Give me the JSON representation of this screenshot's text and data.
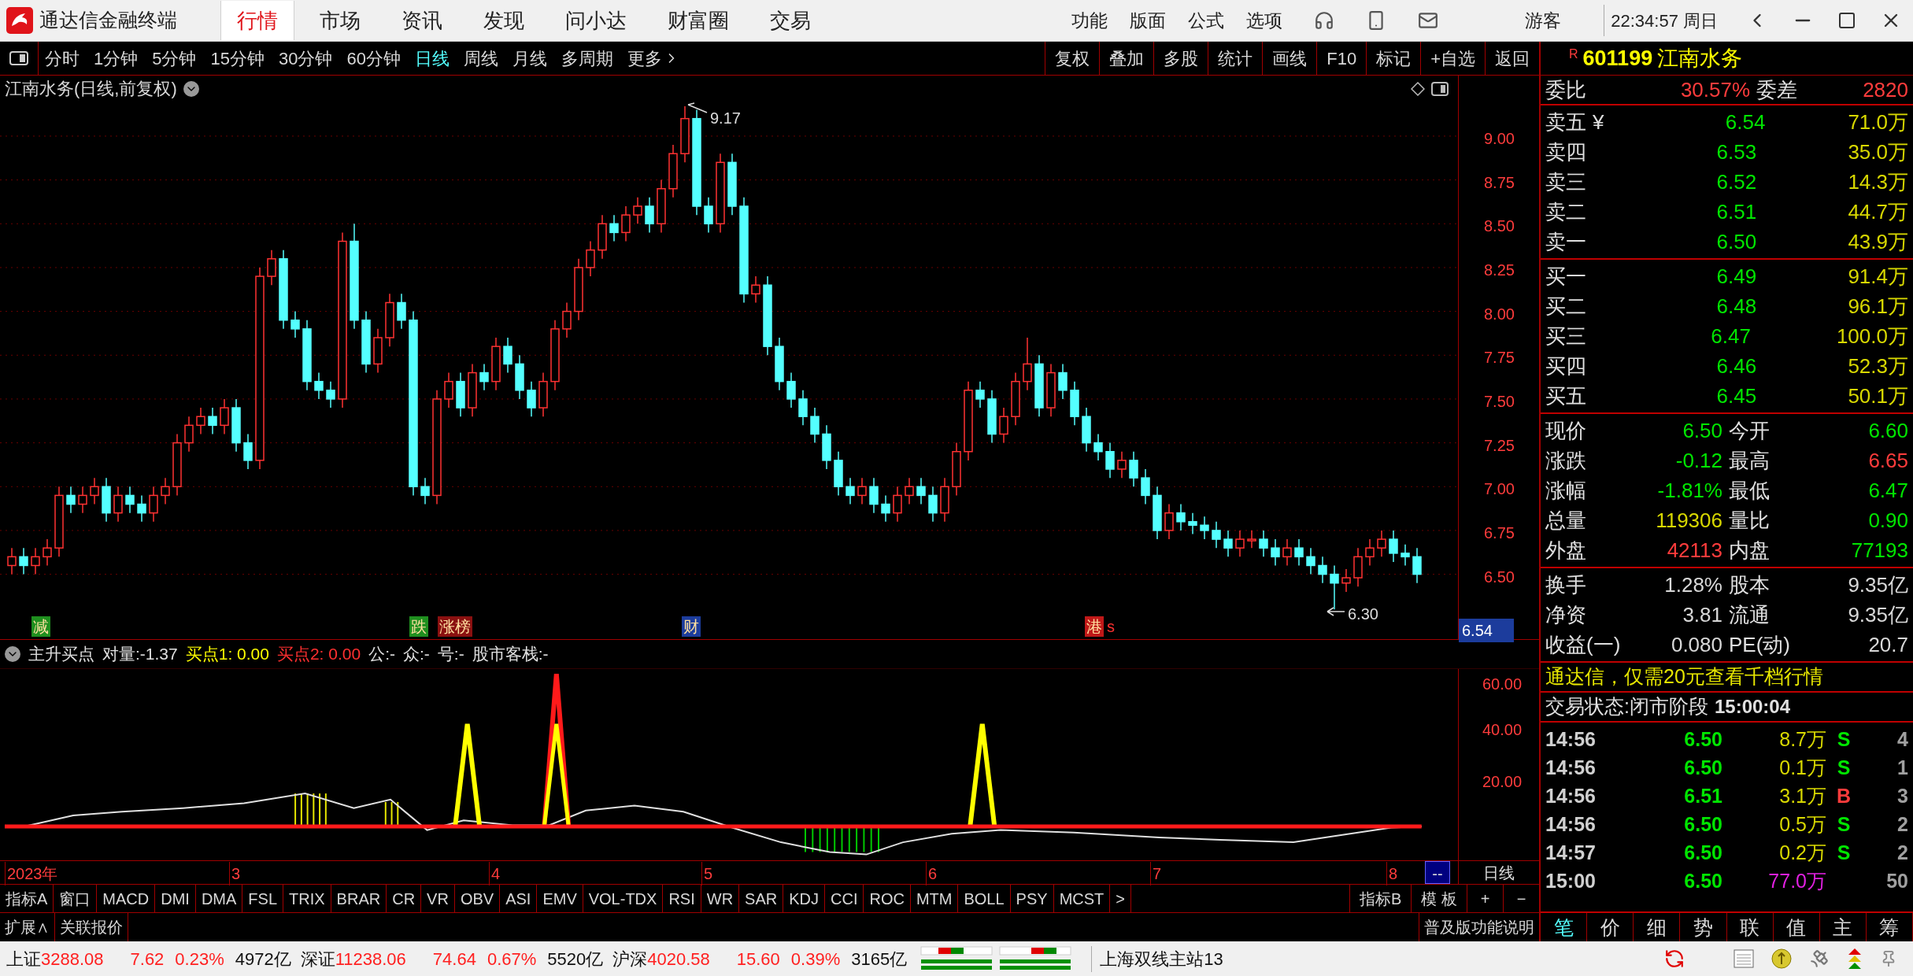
{
  "top_bar": {
    "app_title": "通达信金融终端",
    "tabs": [
      {
        "label": "行情",
        "selected": true
      },
      {
        "label": "市场",
        "selected": false
      },
      {
        "label": "资讯",
        "selected": false
      },
      {
        "label": "发现",
        "selected": false
      },
      {
        "label": "问小达",
        "selected": false
      },
      {
        "label": "财富圈",
        "selected": false
      },
      {
        "label": "交易",
        "selected": false
      }
    ],
    "menus": [
      "功能",
      "版面",
      "公式",
      "选项"
    ],
    "user": "游客",
    "clock": "22:34:57 周日"
  },
  "toolbar": {
    "periods": [
      {
        "label": "分时",
        "selected": false
      },
      {
        "label": "1分钟",
        "selected": false
      },
      {
        "label": "5分钟",
        "selected": false
      },
      {
        "label": "15分钟",
        "selected": false
      },
      {
        "label": "30分钟",
        "selected": false
      },
      {
        "label": "60分钟",
        "selected": false
      },
      {
        "label": "日线",
        "selected": true
      },
      {
        "label": "周线",
        "selected": false
      },
      {
        "label": "月线",
        "selected": false
      },
      {
        "label": "多周期",
        "selected": false
      }
    ],
    "more": "更多",
    "actions": [
      "复权",
      "叠加",
      "多股",
      "统计",
      "画线",
      "F10",
      "标记",
      "+自选",
      "返回"
    ]
  },
  "main_chart": {
    "title": "江南水务(日线,前复权)",
    "chart_data": {
      "type": "candlestick",
      "ylim": [
        6.13,
        9.35
      ],
      "grid": true,
      "yticks": [
        {
          "value": 9.0,
          "label": "9.00"
        },
        {
          "value": 8.75,
          "label": "8.75"
        },
        {
          "value": 8.5,
          "label": "8.50"
        },
        {
          "value": 8.25,
          "label": "8.25"
        },
        {
          "value": 8.0,
          "label": "8.00"
        },
        {
          "value": 7.75,
          "label": "7.75"
        },
        {
          "value": 7.5,
          "label": "7.50"
        },
        {
          "value": 7.25,
          "label": "7.25"
        },
        {
          "value": 7.0,
          "label": "7.00"
        },
        {
          "value": 6.75,
          "label": "6.75"
        },
        {
          "value": 6.5,
          "label": "6.50"
        }
      ],
      "ohlc": [
        [
          6.55,
          6.65,
          6.5,
          6.6
        ],
        [
          6.6,
          6.65,
          6.5,
          6.55
        ],
        [
          6.55,
          6.65,
          6.5,
          6.6
        ],
        [
          6.6,
          6.7,
          6.55,
          6.65
        ],
        [
          6.65,
          7.0,
          6.6,
          6.95
        ],
        [
          6.95,
          7.0,
          6.85,
          6.9
        ],
        [
          6.9,
          7.0,
          6.85,
          6.95
        ],
        [
          6.95,
          7.05,
          6.9,
          7.0
        ],
        [
          7.0,
          7.05,
          6.8,
          6.85
        ],
        [
          6.85,
          7.0,
          6.8,
          6.95
        ],
        [
          6.95,
          7.0,
          6.85,
          6.9
        ],
        [
          6.9,
          6.95,
          6.8,
          6.85
        ],
        [
          6.85,
          7.0,
          6.8,
          6.95
        ],
        [
          6.95,
          7.05,
          6.9,
          7.0
        ],
        [
          7.0,
          7.3,
          6.95,
          7.25
        ],
        [
          7.25,
          7.4,
          7.2,
          7.35
        ],
        [
          7.35,
          7.45,
          7.3,
          7.4
        ],
        [
          7.4,
          7.45,
          7.3,
          7.35
        ],
        [
          7.35,
          7.5,
          7.3,
          7.45
        ],
        [
          7.45,
          7.5,
          7.2,
          7.25
        ],
        [
          7.25,
          7.3,
          7.1,
          7.15
        ],
        [
          7.15,
          8.25,
          7.1,
          8.2
        ],
        [
          8.2,
          8.35,
          8.15,
          8.3
        ],
        [
          8.3,
          8.35,
          7.9,
          7.95
        ],
        [
          7.95,
          8.0,
          7.85,
          7.9
        ],
        [
          7.9,
          7.95,
          7.55,
          7.6
        ],
        [
          7.6,
          7.65,
          7.5,
          7.55
        ],
        [
          7.55,
          7.6,
          7.45,
          7.5
        ],
        [
          7.5,
          8.45,
          7.45,
          8.4
        ],
        [
          8.4,
          8.5,
          7.9,
          7.95
        ],
        [
          7.95,
          8.0,
          7.65,
          7.7
        ],
        [
          7.7,
          7.9,
          7.65,
          7.85
        ],
        [
          7.85,
          8.1,
          7.8,
          8.05
        ],
        [
          8.05,
          8.1,
          7.9,
          7.95
        ],
        [
          7.95,
          8.0,
          6.95,
          7.0
        ],
        [
          7.0,
          7.05,
          6.9,
          6.95
        ],
        [
          6.95,
          7.55,
          6.9,
          7.5
        ],
        [
          7.5,
          7.65,
          7.45,
          7.6
        ],
        [
          7.6,
          7.65,
          7.4,
          7.45
        ],
        [
          7.45,
          7.7,
          7.4,
          7.65
        ],
        [
          7.65,
          7.7,
          7.55,
          7.6
        ],
        [
          7.6,
          7.85,
          7.55,
          7.8
        ],
        [
          7.8,
          7.85,
          7.65,
          7.7
        ],
        [
          7.7,
          7.75,
          7.5,
          7.55
        ],
        [
          7.55,
          7.6,
          7.4,
          7.45
        ],
        [
          7.45,
          7.65,
          7.4,
          7.6
        ],
        [
          7.6,
          7.95,
          7.55,
          7.9
        ],
        [
          7.9,
          8.05,
          7.85,
          8.0
        ],
        [
          8.0,
          8.3,
          7.95,
          8.25
        ],
        [
          8.25,
          8.4,
          8.2,
          8.35
        ],
        [
          8.35,
          8.55,
          8.3,
          8.5
        ],
        [
          8.5,
          8.55,
          8.4,
          8.45
        ],
        [
          8.45,
          8.6,
          8.4,
          8.55
        ],
        [
          8.55,
          8.65,
          8.5,
          8.6
        ],
        [
          8.6,
          8.65,
          8.45,
          8.5
        ],
        [
          8.5,
          8.75,
          8.45,
          8.7
        ],
        [
          8.7,
          8.95,
          8.65,
          8.9
        ],
        [
          8.9,
          9.17,
          8.85,
          9.1
        ],
        [
          9.1,
          9.15,
          8.55,
          8.6
        ],
        [
          8.6,
          8.65,
          8.45,
          8.5
        ],
        [
          8.5,
          8.9,
          8.45,
          8.85
        ],
        [
          8.85,
          8.9,
          8.55,
          8.6
        ],
        [
          8.6,
          8.65,
          8.05,
          8.1
        ],
        [
          8.1,
          8.2,
          8.05,
          8.15
        ],
        [
          8.15,
          8.2,
          7.75,
          7.8
        ],
        [
          7.8,
          7.85,
          7.55,
          7.6
        ],
        [
          7.6,
          7.65,
          7.45,
          7.5
        ],
        [
          7.5,
          7.55,
          7.35,
          7.4
        ],
        [
          7.4,
          7.45,
          7.25,
          7.3
        ],
        [
          7.3,
          7.35,
          7.1,
          7.15
        ],
        [
          7.15,
          7.2,
          6.95,
          7.0
        ],
        [
          7.0,
          7.05,
          6.9,
          6.95
        ],
        [
          6.95,
          7.05,
          6.9,
          7.0
        ],
        [
          7.0,
          7.05,
          6.85,
          6.9
        ],
        [
          6.9,
          6.95,
          6.8,
          6.85
        ],
        [
          6.85,
          7.0,
          6.8,
          6.95
        ],
        [
          6.95,
          7.05,
          6.9,
          7.0
        ],
        [
          7.0,
          7.05,
          6.9,
          6.95
        ],
        [
          6.95,
          7.0,
          6.8,
          6.85
        ],
        [
          6.85,
          7.05,
          6.8,
          7.0
        ],
        [
          7.0,
          7.25,
          6.95,
          7.2
        ],
        [
          7.2,
          7.6,
          7.15,
          7.55
        ],
        [
          7.55,
          7.6,
          7.45,
          7.5
        ],
        [
          7.5,
          7.55,
          7.25,
          7.3
        ],
        [
          7.3,
          7.45,
          7.25,
          7.4
        ],
        [
          7.4,
          7.65,
          7.35,
          7.6
        ],
        [
          7.6,
          7.85,
          7.55,
          7.7
        ],
        [
          7.7,
          7.75,
          7.4,
          7.45
        ],
        [
          7.45,
          7.7,
          7.4,
          7.65
        ],
        [
          7.65,
          7.7,
          7.5,
          7.55
        ],
        [
          7.55,
          7.6,
          7.35,
          7.4
        ],
        [
          7.4,
          7.45,
          7.2,
          7.25
        ],
        [
          7.25,
          7.3,
          7.15,
          7.2
        ],
        [
          7.2,
          7.25,
          7.05,
          7.1
        ],
        [
          7.1,
          7.2,
          7.05,
          7.15
        ],
        [
          7.15,
          7.2,
          7.0,
          7.05
        ],
        [
          7.05,
          7.1,
          6.9,
          6.95
        ],
        [
          6.95,
          7.0,
          6.7,
          6.75
        ],
        [
          6.75,
          6.9,
          6.7,
          6.85
        ],
        [
          6.85,
          6.9,
          6.75,
          6.8
        ],
        [
          6.8,
          6.85,
          6.73,
          6.78
        ],
        [
          6.78,
          6.83,
          6.7,
          6.75
        ],
        [
          6.75,
          6.8,
          6.65,
          6.7
        ],
        [
          6.7,
          6.75,
          6.6,
          6.65
        ],
        [
          6.65,
          6.75,
          6.6,
          6.7
        ],
        [
          6.7,
          6.75,
          6.65,
          6.7
        ],
        [
          6.7,
          6.75,
          6.6,
          6.65
        ],
        [
          6.65,
          6.7,
          6.55,
          6.6
        ],
        [
          6.6,
          6.7,
          6.55,
          6.65
        ],
        [
          6.65,
          6.7,
          6.55,
          6.6
        ],
        [
          6.6,
          6.65,
          6.5,
          6.55
        ],
        [
          6.55,
          6.6,
          6.45,
          6.5
        ],
        [
          6.5,
          6.55,
          6.3,
          6.45
        ],
        [
          6.45,
          6.53,
          6.4,
          6.48
        ],
        [
          6.48,
          6.65,
          6.43,
          6.6
        ],
        [
          6.6,
          6.7,
          6.55,
          6.65
        ],
        [
          6.65,
          6.75,
          6.6,
          6.7
        ],
        [
          6.7,
          6.75,
          6.57,
          6.62
        ],
        [
          6.62,
          6.67,
          6.55,
          6.6
        ],
        [
          6.6,
          6.65,
          6.45,
          6.5
        ]
      ]
    },
    "current_price": "6.54",
    "high_label": "9.17",
    "low_label": "6.30",
    "markers": [
      {
        "text": "减",
        "kind": "tag",
        "color": "#1f8f1f"
      },
      {
        "text": "跌",
        "kind": "tag",
        "color": "#1f8f1f"
      },
      {
        "text": "涨榜",
        "kind": "tag",
        "color": "#8a1010"
      },
      {
        "text": "财",
        "kind": "tag",
        "color": "#1c3c9c"
      },
      {
        "text": "港",
        "kind": "tag",
        "color": "#c01818"
      },
      {
        "text": "s",
        "kind": "text",
        "color": "#ff3030"
      }
    ]
  },
  "indicator": {
    "items": [
      {
        "text": "主升买点",
        "color": "#e0e0e0"
      },
      {
        "text": "对量:-1.37",
        "color": "#e0e0e0"
      },
      {
        "text": "买点1: 0.00",
        "color": "#ffff00"
      },
      {
        "text": "买点2: 0.00",
        "color": "#ff3030"
      },
      {
        "text": "公:-",
        "color": "#e0e0e0"
      },
      {
        "text": "众:-",
        "color": "#e0e0e0"
      },
      {
        "text": "号:-",
        "color": "#e0e0e0"
      },
      {
        "text": "股市客栈:-",
        "color": "#e0e0e0"
      }
    ],
    "ticks": [
      "60.00",
      "40.00",
      "20.00"
    ]
  },
  "date_axis": {
    "labels": [
      "2023年",
      "3",
      "4",
      "5",
      "6",
      "7",
      "8"
    ],
    "cursor": "--",
    "period": "日线"
  },
  "indicator_tabs": {
    "items": [
      "指标A",
      "窗口",
      "MACD",
      "DMI",
      "DMA",
      "FSL",
      "TRIX",
      "BRAR",
      "CR",
      "VR",
      "OBV",
      "ASI",
      "EMV",
      "VOL-TDX",
      "RSI",
      "WR",
      "SAR",
      "KDJ",
      "CCI",
      "ROC",
      "MTM",
      "BOLL",
      "PSY",
      "MCST",
      ">"
    ],
    "right_items": [
      "指标B",
      "模 板",
      "+",
      "−"
    ]
  },
  "extra_row": {
    "items": [
      "扩展∧",
      "关联报价"
    ],
    "help": "普及版功能说明"
  },
  "quote_panel": {
    "badge": "R",
    "code": "601199",
    "name": "江南水务",
    "ratio": {
      "label": "委比",
      "value": "30.57%",
      "label2": "委差",
      "value2": "2820"
    },
    "asks": [
      {
        "label": "卖五",
        "symbol": "¥",
        "price": "6.54",
        "volume": "71.0万"
      },
      {
        "label": "卖四",
        "price": "6.53",
        "volume": "35.0万"
      },
      {
        "label": "卖三",
        "price": "6.52",
        "volume": "14.3万"
      },
      {
        "label": "卖二",
        "price": "6.51",
        "volume": "44.7万"
      },
      {
        "label": "卖一",
        "price": "6.50",
        "volume": "43.9万"
      }
    ],
    "bids": [
      {
        "label": "买一",
        "price": "6.49",
        "volume": "91.4万"
      },
      {
        "label": "买二",
        "price": "6.48",
        "volume": "96.1万"
      },
      {
        "label": "买三",
        "price": "6.47",
        "volume": "100.0万"
      },
      {
        "label": "买四",
        "price": "6.46",
        "volume": "52.3万"
      },
      {
        "label": "买五",
        "price": "6.45",
        "volume": "50.1万"
      }
    ],
    "stats": [
      {
        "left": {
          "label": "现价",
          "value": "6.50",
          "color": "#00e600"
        },
        "right": {
          "label": "今开",
          "value": "6.60",
          "color": "#00e600"
        }
      },
      {
        "left": {
          "label": "涨跌",
          "value": "-0.12",
          "color": "#00e600"
        },
        "right": {
          "label": "最高",
          "value": "6.65",
          "color": "#ff3c3c"
        }
      },
      {
        "left": {
          "label": "涨幅",
          "value": "-1.81%",
          "color": "#00e600"
        },
        "right": {
          "label": "最低",
          "value": "6.47",
          "color": "#00e600"
        }
      },
      {
        "left": {
          "label": "总量",
          "value": "119306",
          "color": "#d8d800"
        },
        "right": {
          "label": "量比",
          "value": "0.90",
          "color": "#00e600"
        }
      },
      {
        "left": {
          "label": "外盘",
          "value": "42113",
          "color": "#ff3c3c"
        },
        "right": {
          "label": "内盘",
          "value": "77193",
          "color": "#00e600"
        }
      }
    ],
    "finance": [
      {
        "left": {
          "label": "换手",
          "value": "1.28%"
        },
        "right": {
          "label": "股本",
          "value": "9.35亿"
        }
      },
      {
        "left": {
          "label": "净资",
          "value": "3.81"
        },
        "right": {
          "label": "流通",
          "value": "9.35亿"
        }
      },
      {
        "left": {
          "label": "收益(一)",
          "value": "0.080"
        },
        "right": {
          "label": "PE(动)",
          "value": "20.7"
        }
      }
    ],
    "ad": "通达信，仅需20元查看千档行情",
    "trade_status": "交易状态:闭市阶段",
    "status_time": "15:00:04",
    "ticks": [
      {
        "time": "14:56",
        "price": "6.50",
        "volume": "8.7万",
        "side": "S",
        "count": "4",
        "kind": "sell"
      },
      {
        "time": "14:56",
        "price": "6.50",
        "volume": "0.1万",
        "side": "S",
        "count": "1",
        "kind": "sell"
      },
      {
        "time": "14:56",
        "price": "6.51",
        "volume": "3.1万",
        "side": "B",
        "count": "3",
        "kind": "buy"
      },
      {
        "time": "14:56",
        "price": "6.50",
        "volume": "0.5万",
        "side": "S",
        "count": "2",
        "kind": "sell"
      },
      {
        "time": "14:57",
        "price": "6.50",
        "volume": "0.2万",
        "side": "S",
        "count": "2",
        "kind": "sell"
      },
      {
        "time": "15:00",
        "price": "6.50",
        "volume": "77.0万",
        "count": "50",
        "kind": "close"
      }
    ],
    "tabs": [
      {
        "label": "笔",
        "selected": true
      },
      {
        "label": "价",
        "selected": false
      },
      {
        "label": "细",
        "selected": false
      },
      {
        "label": "势",
        "selected": false
      },
      {
        "label": "联",
        "selected": false
      },
      {
        "label": "值",
        "selected": false
      },
      {
        "label": "主",
        "selected": false
      },
      {
        "label": "筹",
        "selected": false
      }
    ]
  },
  "status_bar": {
    "indices": [
      {
        "name": "上证",
        "value": "3288.08",
        "change": "7.62",
        "percent": "0.23%",
        "amount": "4972亿"
      },
      {
        "name": "深证",
        "value": "11238.06",
        "change": "74.64",
        "percent": "0.67%",
        "amount": "5520亿"
      },
      {
        "name": "沪深",
        "value": "4020.58",
        "change": "15.60",
        "percent": "0.39%",
        "amount": "3165亿"
      }
    ],
    "server": "上海双线主站13"
  }
}
